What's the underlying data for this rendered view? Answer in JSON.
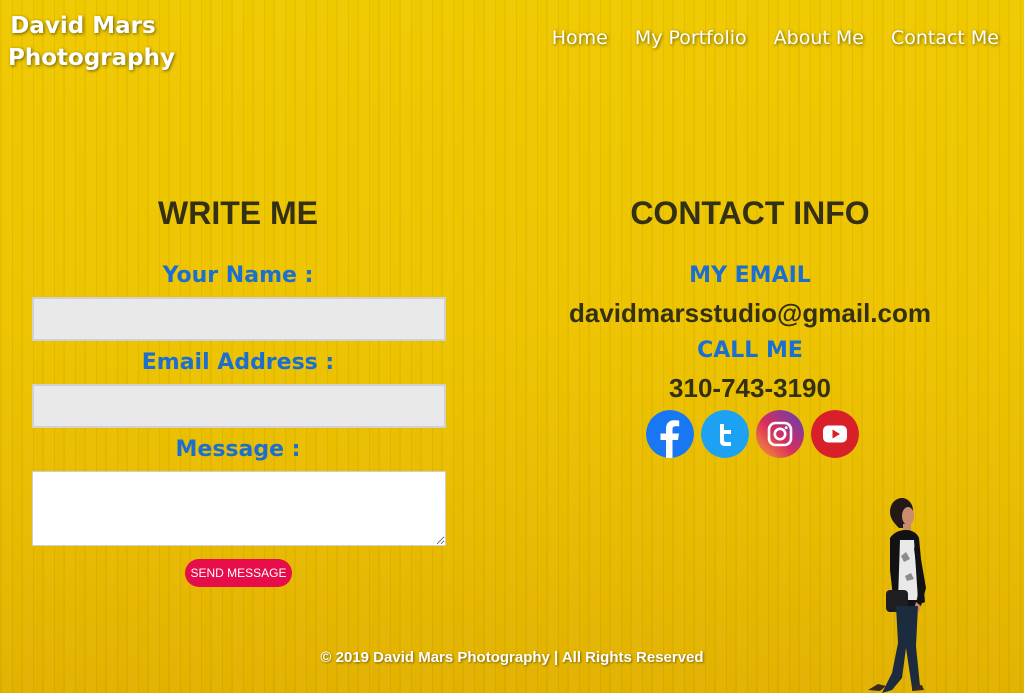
{
  "brand": {
    "line1": "David Mars",
    "line2": "Photography"
  },
  "nav": {
    "items": [
      "Home",
      "My Portfolio",
      "About Me",
      "Contact Me"
    ]
  },
  "write_section": {
    "title": "WRITE ME",
    "name_label": "Your Name :",
    "name_value": "",
    "email_label": "Email Address :",
    "email_value": "",
    "message_label": "Message :",
    "message_value": "",
    "send_label": "SEND MESSAGE"
  },
  "contact_section": {
    "title": "CONTACT INFO",
    "email_label": "MY EMAIL",
    "email_value": "davidmarsstudio@gmail.com",
    "call_label": "CALL ME",
    "phone_value": "310-743-3190"
  },
  "social": [
    {
      "icon": "facebook-icon",
      "color": "#1877f2"
    },
    {
      "icon": "twitter-icon",
      "color": "#1da1f2"
    },
    {
      "icon": "instagram-icon",
      "color": "#c1358f"
    },
    {
      "icon": "youtube-icon",
      "color": "#d8202a"
    }
  ],
  "footer": {
    "text": "© 2019 David Mars Photography | All Rights Reserved"
  },
  "colors": {
    "background": "#eec400",
    "accent_blue": "#1b6fd0",
    "button": "#e60d4a",
    "heading": "#333014"
  }
}
